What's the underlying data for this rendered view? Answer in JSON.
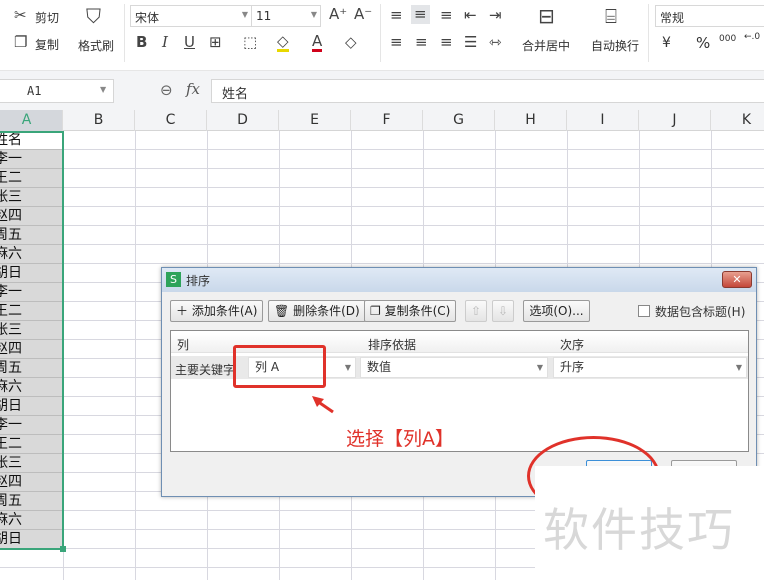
{
  "ribbon": {
    "cut": "剪切",
    "copy": "复制",
    "format_painter": "格式刷",
    "font_name": "宋体",
    "font_size": "11",
    "merge_center": "合并居中",
    "wrap_text": "自动换行",
    "number_format": "常规",
    "currency": "¥",
    "percent": "%",
    "thousands": "000",
    "decimal": "←.0"
  },
  "formula_bar": {
    "name_box": "A1",
    "fx": "fx",
    "value": "姓名"
  },
  "columns": [
    "A",
    "B",
    "C",
    "D",
    "E",
    "F",
    "G",
    "H",
    "I",
    "J",
    "K"
  ],
  "column_a": [
    "姓名",
    "李一",
    "王二",
    "张三",
    "赵四",
    "周五",
    "麻六",
    "胡日",
    "李一",
    "王二",
    "张三",
    "赵四",
    "周五",
    "麻六",
    "胡日",
    "李一",
    "王二",
    "张三",
    "赵四",
    "周五",
    "麻六",
    "胡日"
  ],
  "dialog": {
    "title": "排序",
    "add": "添加条件(A)",
    "delete": "删除条件(D)",
    "copy": "复制条件(C)",
    "options": "选项(O)...",
    "has_header": "数据包含标题(H)",
    "headers": [
      "列",
      "排序依据",
      "次序"
    ],
    "row_label": "主要关键字",
    "column_value": "列 A",
    "basis_value": "数值",
    "order_value": "升序"
  },
  "annotation": {
    "text": "选择【列A】",
    "color": "#e0322a"
  },
  "watermark": "软件技巧"
}
